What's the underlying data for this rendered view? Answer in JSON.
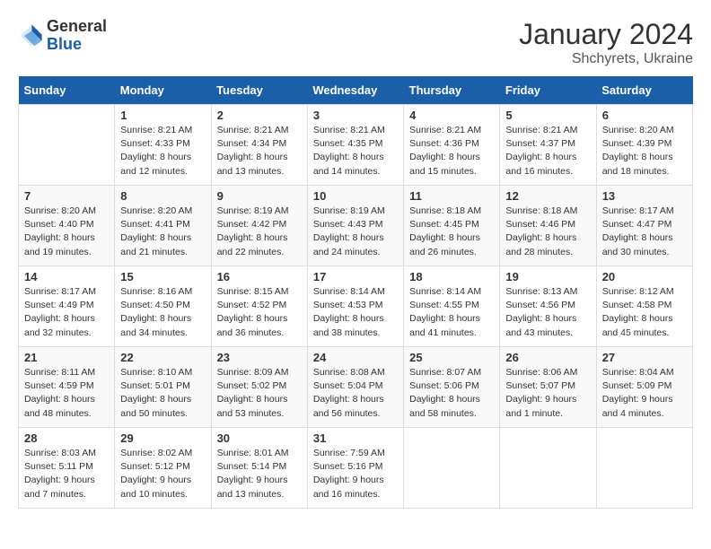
{
  "header": {
    "logo_general": "General",
    "logo_blue": "Blue",
    "month_year": "January 2024",
    "location": "Shchyrets, Ukraine"
  },
  "calendar": {
    "days_of_week": [
      "Sunday",
      "Monday",
      "Tuesday",
      "Wednesday",
      "Thursday",
      "Friday",
      "Saturday"
    ],
    "weeks": [
      [
        {
          "day": "",
          "sunrise": "",
          "sunset": "",
          "daylight": ""
        },
        {
          "day": "1",
          "sunrise": "Sunrise: 8:21 AM",
          "sunset": "Sunset: 4:33 PM",
          "daylight": "Daylight: 8 hours and 12 minutes."
        },
        {
          "day": "2",
          "sunrise": "Sunrise: 8:21 AM",
          "sunset": "Sunset: 4:34 PM",
          "daylight": "Daylight: 8 hours and 13 minutes."
        },
        {
          "day": "3",
          "sunrise": "Sunrise: 8:21 AM",
          "sunset": "Sunset: 4:35 PM",
          "daylight": "Daylight: 8 hours and 14 minutes."
        },
        {
          "day": "4",
          "sunrise": "Sunrise: 8:21 AM",
          "sunset": "Sunset: 4:36 PM",
          "daylight": "Daylight: 8 hours and 15 minutes."
        },
        {
          "day": "5",
          "sunrise": "Sunrise: 8:21 AM",
          "sunset": "Sunset: 4:37 PM",
          "daylight": "Daylight: 8 hours and 16 minutes."
        },
        {
          "day": "6",
          "sunrise": "Sunrise: 8:20 AM",
          "sunset": "Sunset: 4:39 PM",
          "daylight": "Daylight: 8 hours and 18 minutes."
        }
      ],
      [
        {
          "day": "7",
          "sunrise": "Sunrise: 8:20 AM",
          "sunset": "Sunset: 4:40 PM",
          "daylight": "Daylight: 8 hours and 19 minutes."
        },
        {
          "day": "8",
          "sunrise": "Sunrise: 8:20 AM",
          "sunset": "Sunset: 4:41 PM",
          "daylight": "Daylight: 8 hours and 21 minutes."
        },
        {
          "day": "9",
          "sunrise": "Sunrise: 8:19 AM",
          "sunset": "Sunset: 4:42 PM",
          "daylight": "Daylight: 8 hours and 22 minutes."
        },
        {
          "day": "10",
          "sunrise": "Sunrise: 8:19 AM",
          "sunset": "Sunset: 4:43 PM",
          "daylight": "Daylight: 8 hours and 24 minutes."
        },
        {
          "day": "11",
          "sunrise": "Sunrise: 8:18 AM",
          "sunset": "Sunset: 4:45 PM",
          "daylight": "Daylight: 8 hours and 26 minutes."
        },
        {
          "day": "12",
          "sunrise": "Sunrise: 8:18 AM",
          "sunset": "Sunset: 4:46 PM",
          "daylight": "Daylight: 8 hours and 28 minutes."
        },
        {
          "day": "13",
          "sunrise": "Sunrise: 8:17 AM",
          "sunset": "Sunset: 4:47 PM",
          "daylight": "Daylight: 8 hours and 30 minutes."
        }
      ],
      [
        {
          "day": "14",
          "sunrise": "Sunrise: 8:17 AM",
          "sunset": "Sunset: 4:49 PM",
          "daylight": "Daylight: 8 hours and 32 minutes."
        },
        {
          "day": "15",
          "sunrise": "Sunrise: 8:16 AM",
          "sunset": "Sunset: 4:50 PM",
          "daylight": "Daylight: 8 hours and 34 minutes."
        },
        {
          "day": "16",
          "sunrise": "Sunrise: 8:15 AM",
          "sunset": "Sunset: 4:52 PM",
          "daylight": "Daylight: 8 hours and 36 minutes."
        },
        {
          "day": "17",
          "sunrise": "Sunrise: 8:14 AM",
          "sunset": "Sunset: 4:53 PM",
          "daylight": "Daylight: 8 hours and 38 minutes."
        },
        {
          "day": "18",
          "sunrise": "Sunrise: 8:14 AM",
          "sunset": "Sunset: 4:55 PM",
          "daylight": "Daylight: 8 hours and 41 minutes."
        },
        {
          "day": "19",
          "sunrise": "Sunrise: 8:13 AM",
          "sunset": "Sunset: 4:56 PM",
          "daylight": "Daylight: 8 hours and 43 minutes."
        },
        {
          "day": "20",
          "sunrise": "Sunrise: 8:12 AM",
          "sunset": "Sunset: 4:58 PM",
          "daylight": "Daylight: 8 hours and 45 minutes."
        }
      ],
      [
        {
          "day": "21",
          "sunrise": "Sunrise: 8:11 AM",
          "sunset": "Sunset: 4:59 PM",
          "daylight": "Daylight: 8 hours and 48 minutes."
        },
        {
          "day": "22",
          "sunrise": "Sunrise: 8:10 AM",
          "sunset": "Sunset: 5:01 PM",
          "daylight": "Daylight: 8 hours and 50 minutes."
        },
        {
          "day": "23",
          "sunrise": "Sunrise: 8:09 AM",
          "sunset": "Sunset: 5:02 PM",
          "daylight": "Daylight: 8 hours and 53 minutes."
        },
        {
          "day": "24",
          "sunrise": "Sunrise: 8:08 AM",
          "sunset": "Sunset: 5:04 PM",
          "daylight": "Daylight: 8 hours and 56 minutes."
        },
        {
          "day": "25",
          "sunrise": "Sunrise: 8:07 AM",
          "sunset": "Sunset: 5:06 PM",
          "daylight": "Daylight: 8 hours and 58 minutes."
        },
        {
          "day": "26",
          "sunrise": "Sunrise: 8:06 AM",
          "sunset": "Sunset: 5:07 PM",
          "daylight": "Daylight: 9 hours and 1 minute."
        },
        {
          "day": "27",
          "sunrise": "Sunrise: 8:04 AM",
          "sunset": "Sunset: 5:09 PM",
          "daylight": "Daylight: 9 hours and 4 minutes."
        }
      ],
      [
        {
          "day": "28",
          "sunrise": "Sunrise: 8:03 AM",
          "sunset": "Sunset: 5:11 PM",
          "daylight": "Daylight: 9 hours and 7 minutes."
        },
        {
          "day": "29",
          "sunrise": "Sunrise: 8:02 AM",
          "sunset": "Sunset: 5:12 PM",
          "daylight": "Daylight: 9 hours and 10 minutes."
        },
        {
          "day": "30",
          "sunrise": "Sunrise: 8:01 AM",
          "sunset": "Sunset: 5:14 PM",
          "daylight": "Daylight: 9 hours and 13 minutes."
        },
        {
          "day": "31",
          "sunrise": "Sunrise: 7:59 AM",
          "sunset": "Sunset: 5:16 PM",
          "daylight": "Daylight: 9 hours and 16 minutes."
        },
        {
          "day": "",
          "sunrise": "",
          "sunset": "",
          "daylight": ""
        },
        {
          "day": "",
          "sunrise": "",
          "sunset": "",
          "daylight": ""
        },
        {
          "day": "",
          "sunrise": "",
          "sunset": "",
          "daylight": ""
        }
      ]
    ]
  }
}
